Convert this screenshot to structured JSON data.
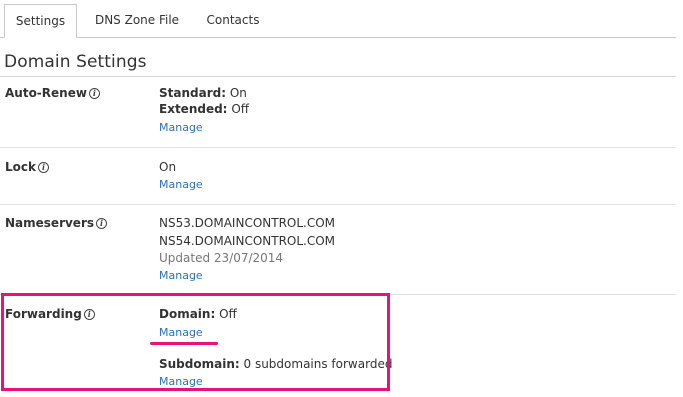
{
  "tabs": [
    {
      "label": "Settings",
      "active": true
    },
    {
      "label": "DNS Zone File",
      "active": false
    },
    {
      "label": "Contacts",
      "active": false
    }
  ],
  "section_title": "Domain Settings",
  "rows": {
    "auto_renew": {
      "label": "Auto-Renew",
      "standard_key": "Standard:",
      "standard_value": "On",
      "extended_key": "Extended:",
      "extended_value": "Off",
      "link": "Manage"
    },
    "lock": {
      "label": "Lock",
      "value": "On",
      "link": "Manage"
    },
    "nameservers": {
      "label": "Nameservers",
      "ns1": "NS53.DOMAINCONTROL.COM",
      "ns2": "NS54.DOMAINCONTROL.COM",
      "updated": "Updated 23/07/2014",
      "link": "Manage"
    },
    "forwarding": {
      "label": "Forwarding",
      "domain_key": "Domain:",
      "domain_value": "Off",
      "domain_link": "Manage",
      "subdomain_key": "Subdomain:",
      "subdomain_value": "0 subdomains forwarded",
      "subdomain_link": "Manage"
    }
  },
  "info_icon_glyph": "i",
  "colors": {
    "link": "#2a73b7",
    "highlight": "#e8127a",
    "text": "#333333"
  }
}
